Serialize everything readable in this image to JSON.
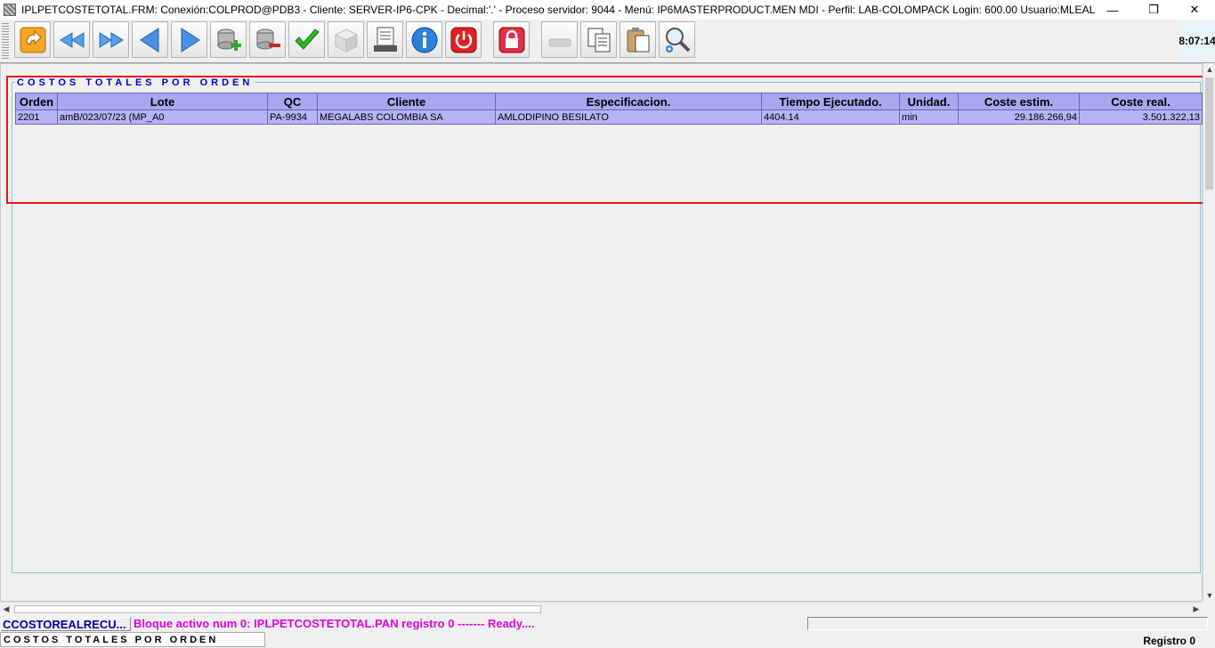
{
  "window": {
    "title": "IPLPETCOSTETOTAL.FRM:        Conexión:COLPROD@PDB3 - Cliente: SERVER-IP6-CPK - Decimal:'.' - Proceso servidor: 9044 - Menú: IP6MASTERPRODUCT.MEN MDI - Perfil: LAB-COLOMPACK Login: 600.00       Usuario:MLEAL",
    "minimize": "—",
    "restore": "❐",
    "close": "✕"
  },
  "toolbar": {
    "clock": "8:07:14",
    "buttons": [
      {
        "id": "refresh",
        "icon": "refresh-icon"
      },
      {
        "id": "first",
        "icon": "rewind-icon"
      },
      {
        "id": "last",
        "icon": "fast-forward-icon"
      },
      {
        "id": "prev",
        "icon": "previous-icon"
      },
      {
        "id": "next",
        "icon": "next-icon"
      },
      {
        "id": "insert",
        "icon": "database-add-icon"
      },
      {
        "id": "delete",
        "icon": "database-remove-icon"
      },
      {
        "id": "accept",
        "icon": "checkmark-icon"
      },
      {
        "id": "cube",
        "icon": "cube-icon"
      },
      {
        "id": "print",
        "icon": "printer-icon"
      },
      {
        "id": "info",
        "icon": "info-icon"
      },
      {
        "id": "power",
        "icon": "power-icon"
      },
      {
        "id": "lock",
        "icon": "lock-icon"
      },
      {
        "id": "blank",
        "icon": "disabled-icon"
      },
      {
        "id": "copy",
        "icon": "copy-icon"
      },
      {
        "id": "paste",
        "icon": "paste-icon"
      },
      {
        "id": "zoom",
        "icon": "magnifier-icon"
      }
    ]
  },
  "panel": {
    "title": "COSTOS TOTALES POR ORDEN",
    "columns": [
      "Orden",
      "Lote",
      "QC",
      "Cliente",
      "Especificacion.",
      "Tiempo Ejecutado.",
      "Unidad.",
      "Coste estim.",
      "Coste real."
    ],
    "rows": [
      [
        "2201",
        "amB/023/07/23 (MP_A0",
        "PA-9934",
        "MEGALABS COLOMBIA SA",
        "AMLODIPINO BESILATO",
        "4404.14",
        "min",
        "29.186.266,94",
        "3.501.322,13"
      ]
    ]
  },
  "status": {
    "block_name": "CCOSTOREALRECU...",
    "message": "Bloque activo num 0: IPLPETCOSTETOTAL.PAN  registro 0 ------- Ready....",
    "form_title": "COSTOS TOTALES POR ORDEN",
    "record": "Registro 0"
  }
}
